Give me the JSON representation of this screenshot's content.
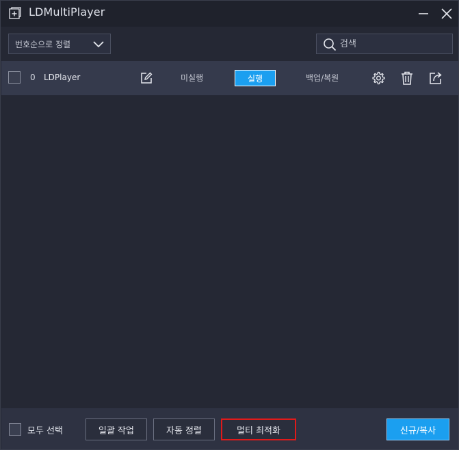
{
  "window": {
    "title": "LDMultiPlayer"
  },
  "toolbar": {
    "sort_label": "번호순으로 정렬",
    "search_placeholder": "검색"
  },
  "players": [
    {
      "index": "0",
      "name": "LDPlayer",
      "status": "미실행",
      "run_label": "실행",
      "backup_label": "백업/복원"
    }
  ],
  "footer": {
    "select_all_label": "모두 선택",
    "batch_label": "일괄 작업",
    "auto_sort_label": "자동 정렬",
    "multi_optimize_label": "멀티 최적화",
    "new_copy_label": "신규/복사"
  },
  "colors": {
    "accent": "#1b9ff0",
    "highlight": "#e01a1a",
    "background": "#252834",
    "row": "#353a4c"
  },
  "icons": [
    "app-logo-icon",
    "minimize-icon",
    "close-icon",
    "chevron-down-icon",
    "search-icon",
    "edit-icon",
    "gear-icon",
    "trash-icon",
    "share-icon"
  ]
}
